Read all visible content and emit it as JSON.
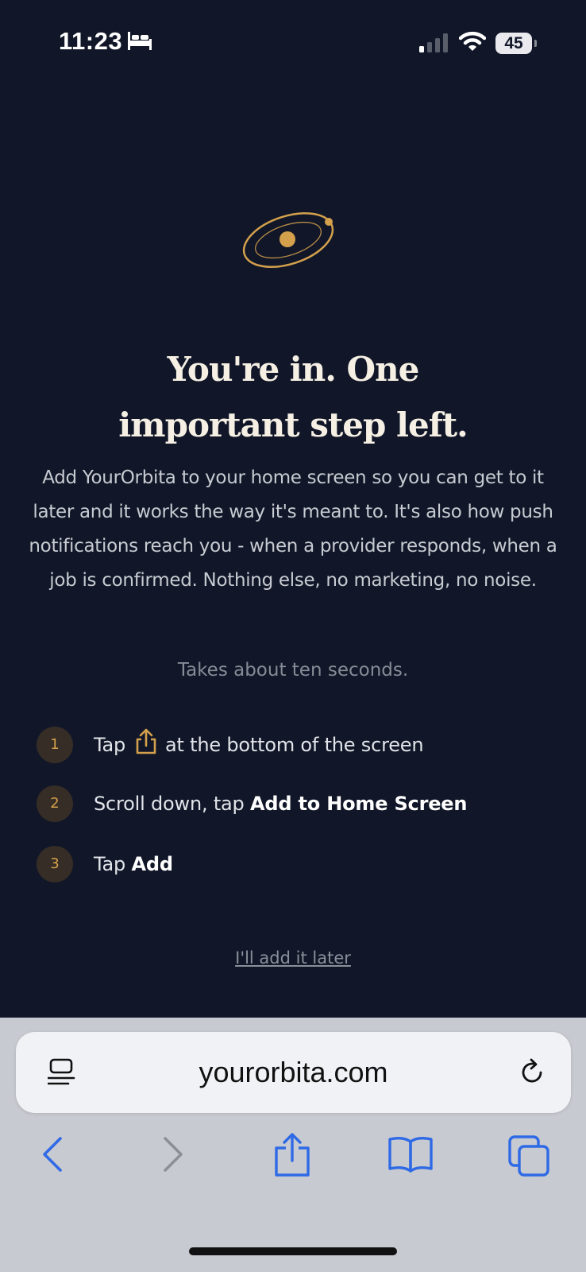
{
  "status_bar": {
    "time": "11:23",
    "battery": "45",
    "icons": [
      "bed-icon",
      "cellular-signal-icon",
      "wifi-icon",
      "battery-icon"
    ]
  },
  "colors": {
    "background": "#111728",
    "accent": "#d4a04c",
    "headline": "#f5efe4",
    "browser_chrome": "#c8cad1",
    "browser_icon": "#2f6ae6"
  },
  "logo": {
    "icon": "orbit-logo-icon"
  },
  "headline": {
    "line1": "You're in. One",
    "line2": "important step left."
  },
  "description": "Add YourOrbita to your home screen so you can get to it later and it works the way it's meant to. It's also how push notifications reach you - when a provider responds, when a job is confirmed. Nothing else, no marketing, no noise.",
  "duration_note": "Takes about ten seconds.",
  "steps": [
    {
      "number": "1",
      "text_before": "Tap",
      "icon": "share-icon",
      "text_after": "at the bottom of the screen"
    },
    {
      "number": "2",
      "text_before": "Scroll down, tap",
      "bold": "Add to Home Screen"
    },
    {
      "number": "3",
      "text_before": "Tap",
      "bold": "Add"
    }
  ],
  "later_link": "I'll add it later",
  "browser": {
    "url": "yourorbita.com",
    "toolbar_icons": [
      "back-icon",
      "forward-icon",
      "share-icon",
      "bookmarks-icon",
      "tabs-icon"
    ]
  }
}
